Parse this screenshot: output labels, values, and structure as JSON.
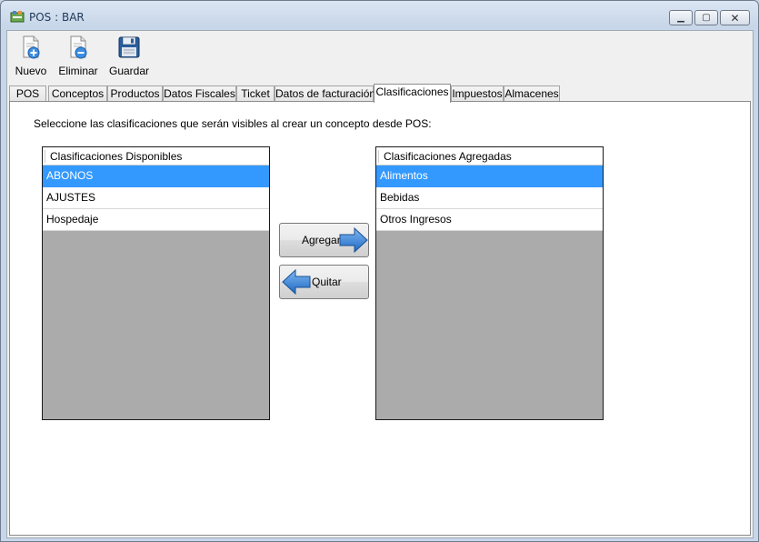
{
  "window": {
    "title": "POS : BAR",
    "controls": {
      "minimize": "▁",
      "maximize": "▢",
      "close": "✕"
    }
  },
  "toolbar": {
    "items": [
      {
        "label": "Nuevo",
        "icon": "new-document-icon"
      },
      {
        "label": "Eliminar",
        "icon": "delete-document-icon"
      },
      {
        "label": "Guardar",
        "icon": "floppy-disk-icon"
      }
    ]
  },
  "tabs": [
    {
      "label": "POS"
    },
    {
      "label": "Conceptos"
    },
    {
      "label": "Productos"
    },
    {
      "label": "Datos Fiscales"
    },
    {
      "label": "Ticket"
    },
    {
      "label": "Datos de facturación"
    },
    {
      "label": "Clasificaciones",
      "active": true
    },
    {
      "label": "Impuestos"
    },
    {
      "label": "Almacenes"
    }
  ],
  "panel": {
    "instruction": "Seleccione las clasificaciones que serán visibles al crear un concepto desde POS:",
    "available": {
      "header": "Clasificaciones Disponibles",
      "items": [
        "ABONOS",
        "AJUSTES",
        "Hospedaje"
      ],
      "selected_index": 0
    },
    "added": {
      "header": "Clasificaciones Agregadas",
      "items": [
        "Alimentos",
        "Bebidas",
        "Otros Ingresos"
      ],
      "selected_index": 0
    },
    "buttons": {
      "add": "Agregar",
      "remove": "Quitar"
    }
  },
  "colors": {
    "selection": "#3399ff",
    "list_empty": "#ababab",
    "arrow": "#2f7fd6"
  }
}
